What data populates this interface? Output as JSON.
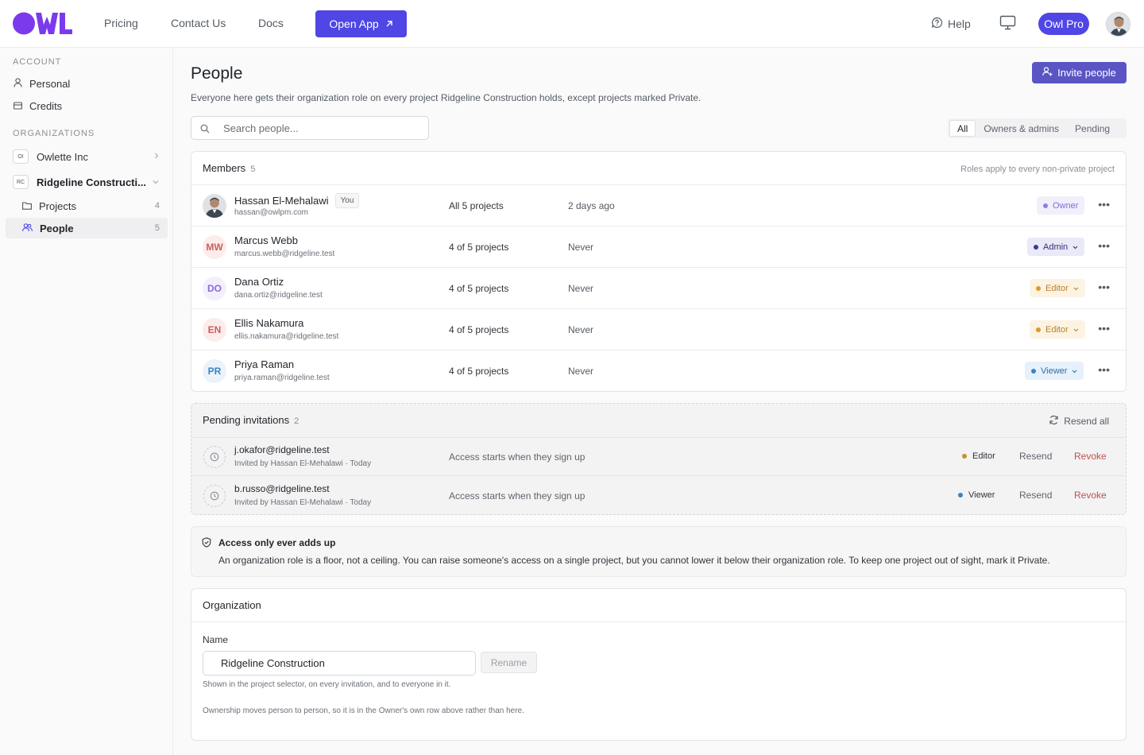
{
  "nav": {
    "links": [
      "Pricing",
      "Contact Us",
      "Docs"
    ],
    "open_app": "Open App",
    "help": "Help",
    "plan_badge": "Owl Pro",
    "accent": "#4f46e5"
  },
  "sidebar": {
    "account_label": "ACCOUNT",
    "account_items": [
      "Personal",
      "Credits"
    ],
    "orgs_label": "ORGANIZATIONS",
    "orgs": [
      {
        "chip": "OI",
        "name": "Owlette Inc"
      },
      {
        "chip": "RC",
        "name": "Ridgeline Constructi..."
      }
    ],
    "org_sub": [
      {
        "label": "Projects",
        "count": "4"
      },
      {
        "label": "People",
        "count": "5"
      }
    ]
  },
  "page": {
    "title": "People",
    "description": "Everyone here gets their organization role on every project Ridgeline Construction holds, except projects marked Private.",
    "invite_button": "Invite people",
    "search_placeholder": "Search people...",
    "filters": [
      "All",
      "Owners & admins",
      "Pending"
    ]
  },
  "members": {
    "title": "Members",
    "count": "5",
    "note": "Roles apply to every non-private project",
    "you_badge": "You",
    "rows": [
      {
        "initials": "",
        "name": "Hassan El-Mehalawi",
        "email": "hassan@owlpm.com",
        "projects": "All 5 projects",
        "last_seen": "2 days ago",
        "role": "Owner"
      },
      {
        "initials": "MW",
        "name": "Marcus Webb",
        "email": "marcus.webb@ridgeline.test",
        "projects": "4 of 5 projects",
        "last_seen": "Never",
        "role": "Admin"
      },
      {
        "initials": "DO",
        "name": "Dana Ortiz",
        "email": "dana.ortiz@ridgeline.test",
        "projects": "4 of 5 projects",
        "last_seen": "Never",
        "role": "Editor"
      },
      {
        "initials": "EN",
        "name": "Ellis Nakamura",
        "email": "ellis.nakamura@ridgeline.test",
        "projects": "4 of 5 projects",
        "last_seen": "Never",
        "role": "Editor"
      },
      {
        "initials": "PR",
        "name": "Priya Raman",
        "email": "priya.raman@ridgeline.test",
        "projects": "4 of 5 projects",
        "last_seen": "Never",
        "role": "Viewer"
      }
    ]
  },
  "pending": {
    "title": "Pending invitations",
    "count": "2",
    "resend_all": "Resend all",
    "rows": [
      {
        "email": "j.okafor@ridgeline.test",
        "invited_by": "Invited by Hassan El-Mehalawi · Today",
        "status": "Access starts when they sign up",
        "role": "Editor",
        "resend": "Resend",
        "revoke": "Revoke"
      },
      {
        "email": "b.russo@ridgeline.test",
        "invited_by": "Invited by Hassan El-Mehalawi · Today",
        "status": "Access starts when they sign up",
        "role": "Viewer",
        "resend": "Resend",
        "revoke": "Revoke"
      }
    ]
  },
  "notice": {
    "title": "Access only ever adds up",
    "text": "An organization role is a floor, not a ceiling. You can raise someone's access on a single project, but you cannot lower it below their organization role. To keep one project out of sight, mark it Private."
  },
  "organization": {
    "title": "Organization",
    "name_label": "Name",
    "name_value": "Ridgeline Construction",
    "rename_button": "Rename",
    "hint1": "Shown in the project selector, on every invitation, and to everyone in it.",
    "hint2": "Ownership moves person to person, so it is in the Owner's own row above rather than here."
  },
  "role_colors": {
    "Owner": "#7c6fd6",
    "Admin": "#3b3a8f",
    "Editor": "#d99a2b",
    "Viewer": "#3b82c4"
  }
}
